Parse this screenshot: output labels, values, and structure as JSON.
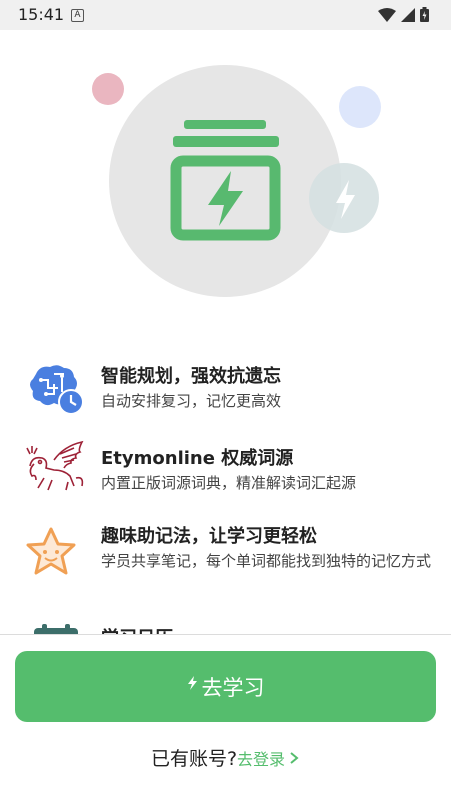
{
  "status_bar": {
    "time": "15:41",
    "notification_icon": "A"
  },
  "features": [
    {
      "icon": "brain-clock-icon",
      "title": "智能规划，强效抗遗忘",
      "desc": "自动安排复习，记忆更高效"
    },
    {
      "icon": "winged-lion-icon",
      "title": "Etymonline 权威词源",
      "desc": "内置正版词源词典，精准解读词汇起源"
    },
    {
      "icon": "smiling-star-icon",
      "title": "趣味助记法，让学习更轻松",
      "desc": "学员共享笔记，每个单词都能找到独特的记忆方式"
    },
    {
      "icon": "calendar-icon",
      "title": "学习日历",
      "desc": ""
    }
  ],
  "primary_button": {
    "label": "去学习",
    "icon": "lightning-icon"
  },
  "login": {
    "prompt": "已有账号?",
    "link": "去登录",
    "chevron": "chevron-right-icon"
  },
  "colors": {
    "accent": "#55bd6d",
    "hero_circle": "#e6e6e6",
    "brain_blue": "#4a7fe0",
    "lion_red": "#9e2237",
    "star_orange": "#f0a054"
  }
}
